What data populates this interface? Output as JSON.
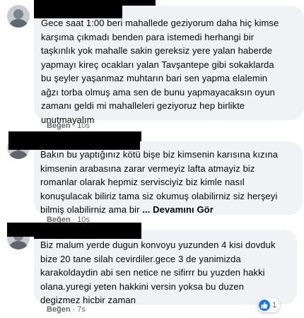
{
  "comments": [
    {
      "lines": [
        "Gece saat 1:00 beri mahallede geziyorum daha hiç kimse",
        "karşıma çıkmadı benden para istemedi herhangi bir",
        "taşkınlık yok mahalle sakin gereksiz yere yalan haberde",
        "yapmayı kireç ocakları yalan Tavşantepe gibi sokaklarda",
        "bu şeyler yaşanmaz muhtarın bari sen yapma elalemin",
        "ağzı torba olmuş ama sen de bunu yapmayacaksın oyun",
        "zamanı geldi mi mahalleleri geziyoruz hep birlikte",
        "unutmayalım"
      ],
      "like_label": "Beğen",
      "separator": "·",
      "time": "10s"
    },
    {
      "lines": [
        "Bakın bu yaptığınız kötü bişe biz kimsenin karısına kızına",
        "kimsenin arabasına zarar vermeyiz lafta atmayiz biz",
        "romanlar olarak hepmiz servisciyiz biz kimle nasıl",
        "konuşulacak biliriz tama siz okumuş olabilirniz siz herşeyi"
      ],
      "last_line": "bilmiş olabilirniz ama bir ",
      "see_more": "... Devamını Gör",
      "like_label": "Beğen",
      "separator": "·",
      "time": "10s"
    },
    {
      "lines": [
        "Biz malum yerde dugun konvoyu yuzunden 4 kisi dovduk",
        "bize 20 tane silah cevirdiler.gece 3 de yanimizda",
        "karakoldaydin abi sen netice ne sifirrr bu yuzden hakki",
        "olana.yuregi yeten hakkini versin yoksa bu duzen",
        "degizmez hicbir zaman"
      ],
      "like_label": "Beğen",
      "separator": "·",
      "time": "7s",
      "reaction_count": "1"
    }
  ],
  "colors": {
    "bubble": "#f0f2f5",
    "text": "#050505",
    "meta": "#65676b",
    "like_blue": "#1877f2",
    "redaction": "#000000"
  },
  "icons": {
    "avatar": "default-avatar-icon",
    "reaction": "thumbs-up-icon"
  }
}
